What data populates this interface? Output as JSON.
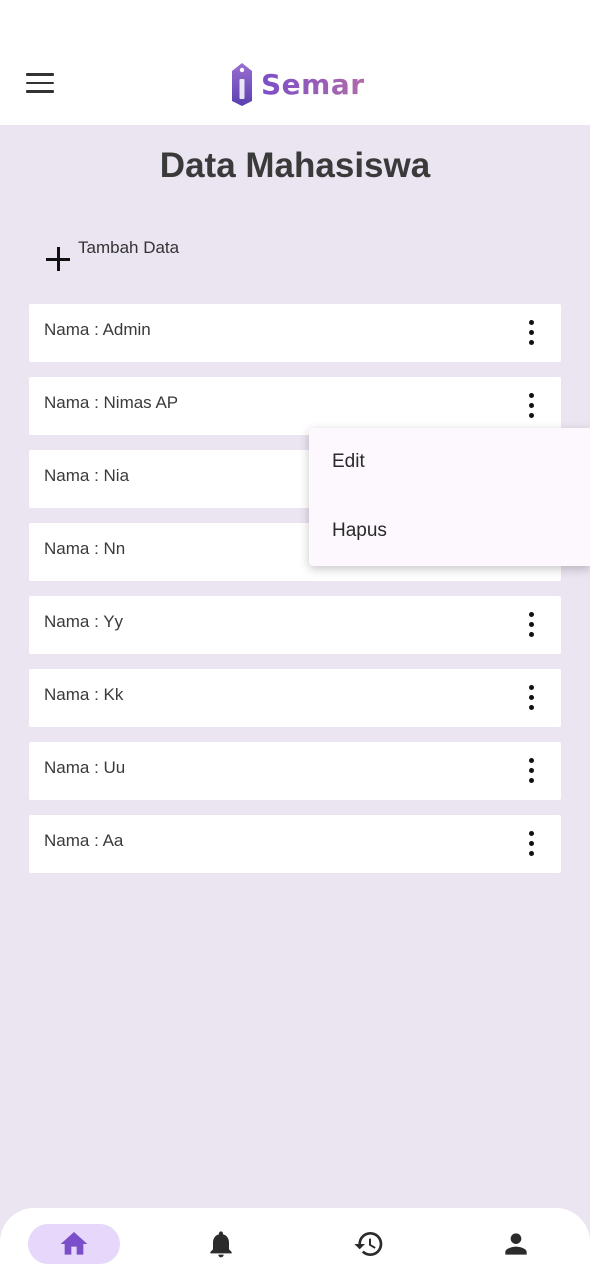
{
  "app": {
    "brand": "Semar",
    "accent_color": "#7b4fc9"
  },
  "page": {
    "title": "Data Mahasiswa"
  },
  "toolbar": {
    "add_label": "Tambah Data",
    "add_icon": "plus-icon"
  },
  "students": [
    {
      "label": "Nama : Admin"
    },
    {
      "label": "Nama : Nimas AP"
    },
    {
      "label": "Nama : Nia"
    },
    {
      "label": "Nama : Nn"
    },
    {
      "label": "Nama : Yy"
    },
    {
      "label": "Nama : Kk"
    },
    {
      "label": "Nama : Uu"
    },
    {
      "label": "Nama : Aa"
    }
  ],
  "context_menu": {
    "items": [
      {
        "label": "Edit"
      },
      {
        "label": "Hapus"
      }
    ]
  },
  "bottom_nav": {
    "items": [
      {
        "icon": "home-icon",
        "active": true
      },
      {
        "icon": "bell-icon",
        "active": false
      },
      {
        "icon": "history-icon",
        "active": false
      },
      {
        "icon": "person-icon",
        "active": false
      }
    ]
  }
}
